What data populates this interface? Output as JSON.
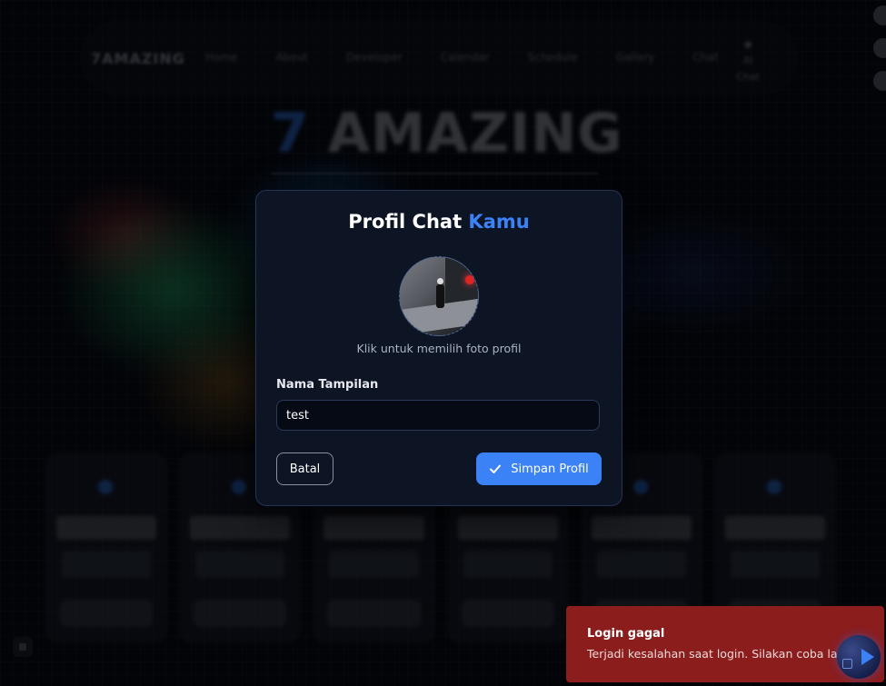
{
  "navbar": {
    "brand": "7AMAZING",
    "links": [
      "Home",
      "About",
      "Developer",
      "Calendar",
      "Schedule",
      "Gallery",
      "Chat"
    ],
    "chat_label": "AI\nChat"
  },
  "hero": {
    "number": "7",
    "title": "AMAZING"
  },
  "modal": {
    "title_main": "Profil Chat",
    "title_accent": "Kamu",
    "avatar_caption": "Klik untuk memilih foto profil",
    "name_label": "Nama Tampilan",
    "name_value": "test",
    "cancel_label": "Batal",
    "save_label": "Simpan Profil"
  },
  "toast": {
    "title": "Login gagal",
    "message": "Terjadi kesalahan saat login. Silakan coba lagi."
  },
  "colors": {
    "accent": "#3b82f6",
    "toast_bg": "#8b1d1d",
    "modal_bg": "#0d1424"
  }
}
